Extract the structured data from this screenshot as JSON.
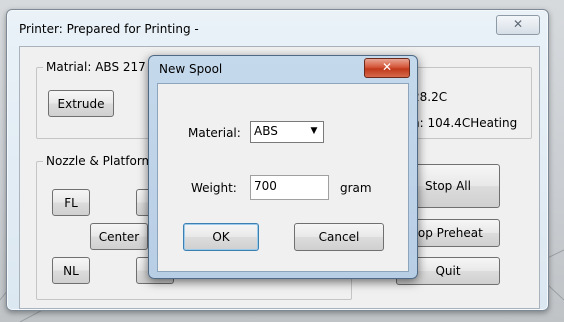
{
  "main_window": {
    "title": "Printer: Prepared for Printing -",
    "close_label": "✕"
  },
  "material_group": {
    "label": "Matrial: ABS 217",
    "extrude_label": "Extrude"
  },
  "temps": {
    "line1": "28.2C",
    "line2": "n: 104.4CHeating"
  },
  "nozzle_group": {
    "label": "Nozzle & Platform",
    "fl_label": "FL",
    "fr_label": "F",
    "center_label": "Center",
    "nl_label": "NL",
    "nr_label": "N"
  },
  "right_buttons": {
    "stop_all": "Stop All",
    "stop_preheat": "top Preheat",
    "quit": "Quit"
  },
  "dialog": {
    "title": "New Spool",
    "close_label": "✕",
    "material_label": "Material:",
    "material_value": "ABS",
    "weight_label": "Weight:",
    "weight_value": "700",
    "weight_unit": "gram",
    "ok_label": "OK",
    "cancel_label": "Cancel"
  },
  "icons": {
    "dropdown": "▼"
  }
}
